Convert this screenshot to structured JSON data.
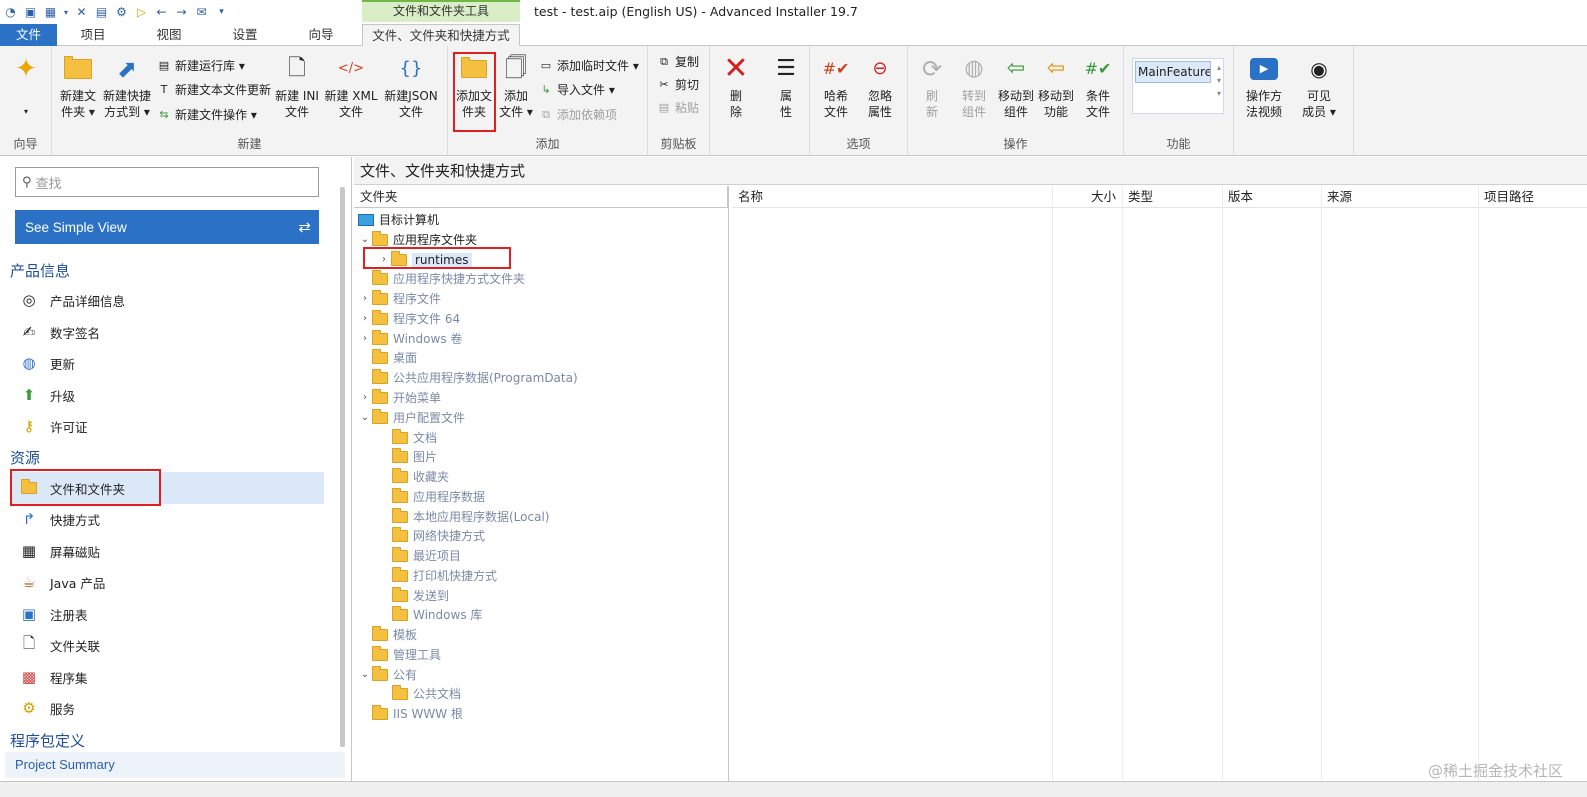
{
  "window": {
    "title": "test - test.aip (English US) - Advanced Installer 19.7",
    "context_group": "文件和文件夹工具"
  },
  "tabs": [
    {
      "label": "文件"
    },
    {
      "label": "项目"
    },
    {
      "label": "视图"
    },
    {
      "label": "设置"
    },
    {
      "label": "向导"
    },
    {
      "label": "文件、文件夹和快捷方式"
    }
  ],
  "ribbon": {
    "groups": {
      "wizard": "向导",
      "new": "新建",
      "add": "添加",
      "clipboard": "剪贴板",
      "options": "选项",
      "operations": "操作",
      "feature": "功能"
    },
    "new_folder": "新建文\n件夹 ▾",
    "new_shortcut": "新建快捷\n方式到 ▾",
    "new_launcher": "新建运行库 ▾",
    "new_text_update": "新建文本文件更新",
    "new_file_op": "新建文件操作 ▾",
    "new_ini": "新建 INI\n文件",
    "new_xml": "新建 XML\n文件",
    "new_json": "新建JSON\n文件",
    "add_folder": "添加文\n件夹",
    "add_file": "添加\n文件 ▾",
    "add_temp": "添加临时文件 ▾",
    "import_files": "导入文件 ▾",
    "add_dependency": "添加依赖项",
    "copy": "复制",
    "cut": "剪切",
    "paste": "粘贴",
    "delete": "删\n除",
    "properties": "属\n性",
    "hash_file": "哈希\n文件",
    "ignore_attr": "忽略\n属性",
    "refresh": "刷\n新",
    "to_component": "转到\n组件",
    "move_to_component": "移动到\n组件",
    "move_to_feature": "移动到\n功能",
    "condition_file": "条件\n文件",
    "feature_value": "MainFeature",
    "how_to_video": "操作方\n法视频",
    "visible_members": "可见\n成员 ▾"
  },
  "sidebar": {
    "search_placeholder": "查找",
    "simple_view": "See Simple View",
    "sections": {
      "product": "产品信息",
      "resources": "资源",
      "package": "程序包定义"
    },
    "product_items": [
      "产品详细信息",
      "数字签名",
      "更新",
      "升级",
      "许可证"
    ],
    "resource_items": [
      "文件和文件夹",
      "快捷方式",
      "屏幕磁贴",
      "Java 产品",
      "注册表",
      "文件关联",
      "程序集",
      "服务"
    ],
    "summary": "Project Summary"
  },
  "main": {
    "header": "文件、文件夹和快捷方式",
    "tree_header": "文件夹",
    "tree": [
      {
        "label": "目标计算机"
      },
      {
        "label": "应用程序文件夹"
      },
      {
        "label": "runtimes"
      },
      {
        "label": "应用程序快捷方式文件夹"
      },
      {
        "label": "程序文件"
      },
      {
        "label": "程序文件 64"
      },
      {
        "label": "Windows 卷"
      },
      {
        "label": "桌面"
      },
      {
        "label": "公共应用程序数据(ProgramData)"
      },
      {
        "label": "开始菜单"
      },
      {
        "label": "用户配置文件"
      },
      {
        "label": "文档"
      },
      {
        "label": "图片"
      },
      {
        "label": "收藏夹"
      },
      {
        "label": "应用程序数据"
      },
      {
        "label": "本地应用程序数据(Local)"
      },
      {
        "label": "网络快捷方式"
      },
      {
        "label": "最近项目"
      },
      {
        "label": "打印机快捷方式"
      },
      {
        "label": "发送到"
      },
      {
        "label": "Windows 库"
      },
      {
        "label": "模板"
      },
      {
        "label": "管理工具"
      },
      {
        "label": "公有"
      },
      {
        "label": "公共文档"
      },
      {
        "label": "IIS WWW 根"
      }
    ],
    "columns": [
      "名称",
      "大小",
      "类型",
      "版本",
      "来源",
      "项目路径"
    ]
  },
  "watermark": "@稀土掘金技术社区"
}
